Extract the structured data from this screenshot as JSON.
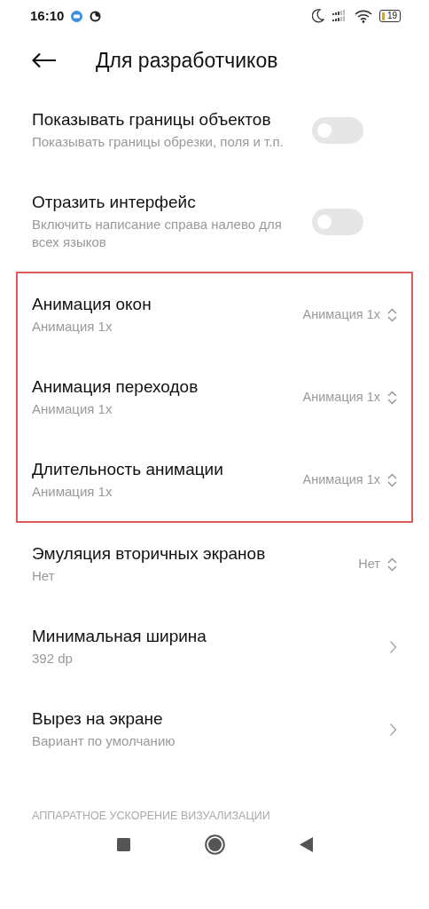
{
  "status_bar": {
    "time": "16:10",
    "battery": "19"
  },
  "header": {
    "title": "Для разработчиков"
  },
  "items": [
    {
      "kind": "toggle",
      "title": "Показывать границы объектов",
      "subtitle": "Показывать границы обрезки, поля и т.п.",
      "on": false,
      "highlighted": false
    },
    {
      "kind": "toggle",
      "title": "Отразить интерфейс",
      "subtitle": "Включить написание справа налево для всех языков",
      "on": false,
      "highlighted": false
    },
    {
      "kind": "select",
      "title": "Анимация окон",
      "subtitle": "Анимация 1x",
      "value": "Анимация 1x",
      "highlighted": true
    },
    {
      "kind": "select",
      "title": "Анимация переходов",
      "subtitle": "Анимация 1x",
      "value": "Анимация 1x",
      "highlighted": true
    },
    {
      "kind": "select",
      "title": "Длительность анимации",
      "subtitle": "Анимация 1x",
      "value": "Анимация 1x",
      "highlighted": true
    },
    {
      "kind": "select",
      "title": "Эмуляция вторичных экранов",
      "subtitle": "Нет",
      "value": "Нет",
      "highlighted": false
    },
    {
      "kind": "link",
      "title": "Минимальная ширина",
      "subtitle": "392 dp",
      "highlighted": false
    },
    {
      "kind": "link",
      "title": "Вырез на экране",
      "subtitle": "Вариант по умолчанию",
      "highlighted": false
    }
  ],
  "section_header": "АППАРАТНОЕ УСКОРЕНИЕ ВИЗУАЛИЗАЦИИ"
}
